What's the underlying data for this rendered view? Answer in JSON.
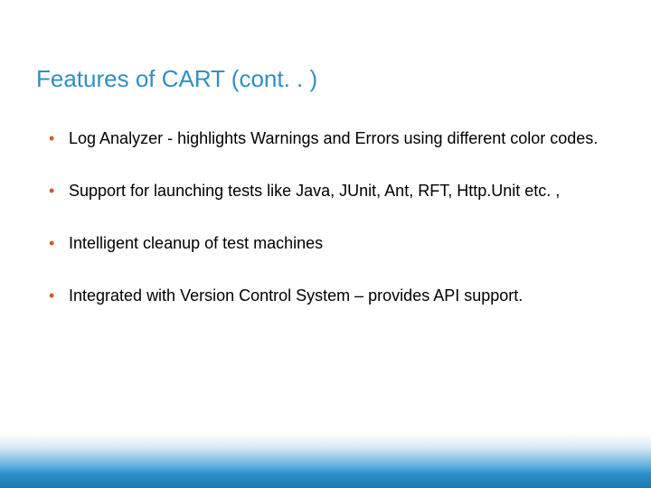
{
  "title": "Features of CART (cont. . )",
  "bullets": [
    "Log Analyzer - highlights Warnings and Errors using different color codes.",
    "Support for launching tests like Java, JUnit, Ant, RFT, Http.Unit etc. ,",
    "Intelligent cleanup of test machines",
    "Integrated with Version Control System – provides API support."
  ]
}
